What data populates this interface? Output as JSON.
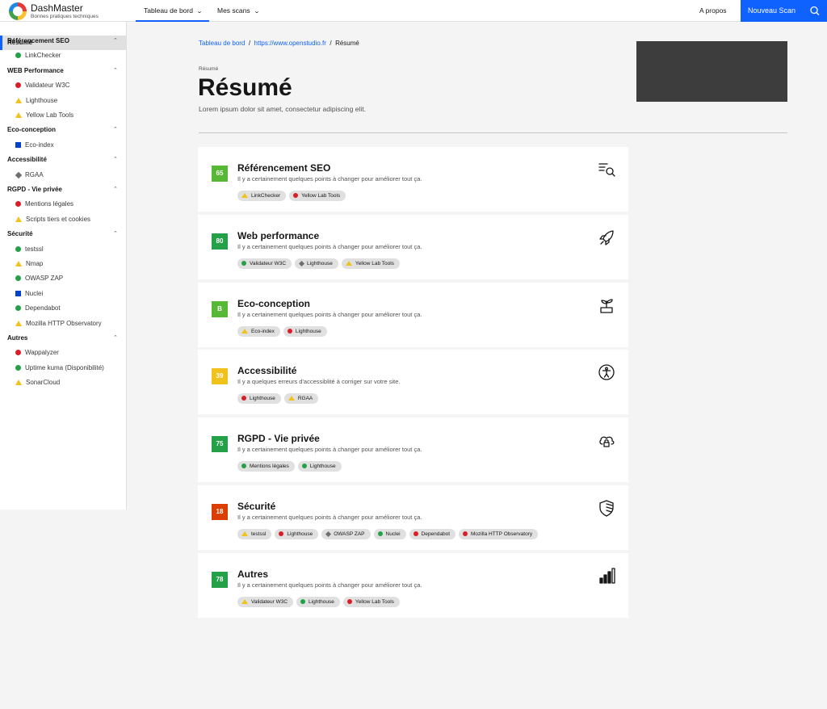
{
  "header": {
    "brand": "DashMaster",
    "subtitle": "Bonnes pratiques techniques",
    "nav": [
      {
        "label": "Tableau de bord"
      },
      {
        "label": "Mes scans"
      }
    ],
    "apropos": "A propos",
    "new_scan": "Nouveau Scan"
  },
  "sidebar": {
    "resume": "Résumé",
    "categories": [
      {
        "label": "Référencement SEO",
        "items": [
          {
            "label": "LinkChecker",
            "status": "ok"
          }
        ]
      },
      {
        "label": "WEB Performance",
        "items": [
          {
            "label": "Validateur W3C",
            "status": "err"
          },
          {
            "label": "Lighthouse",
            "status": "warn"
          },
          {
            "label": "Yellow Lab Tools",
            "status": "warn"
          }
        ]
      },
      {
        "label": "Eco-conception",
        "items": [
          {
            "label": "Eco-index",
            "status": "info"
          }
        ]
      },
      {
        "label": "Accessibilité",
        "items": [
          {
            "label": "RGAA",
            "status": "na"
          }
        ]
      },
      {
        "label": "RGPD - Vie privée",
        "items": [
          {
            "label": "Mentions légales",
            "status": "err"
          },
          {
            "label": "Scripts tiers et cookies",
            "status": "warn"
          }
        ]
      },
      {
        "label": "Sécurité",
        "items": [
          {
            "label": "testssl",
            "status": "ok"
          },
          {
            "label": "Nmap",
            "status": "warn"
          },
          {
            "label": "OWASP ZAP",
            "status": "ok"
          },
          {
            "label": "Nuclei",
            "status": "info"
          },
          {
            "label": "Dependabot",
            "status": "ok"
          },
          {
            "label": "Mozilla HTTP Observatory",
            "status": "warn"
          }
        ]
      },
      {
        "label": "Autres",
        "items": [
          {
            "label": "Wappalyzer",
            "status": "err"
          },
          {
            "label": "Uptime kuma (Disponibilité)",
            "status": "ok"
          },
          {
            "label": "SonarCloud",
            "status": "warn"
          }
        ]
      }
    ]
  },
  "breadcrumb": {
    "home": "Tableau de bord",
    "site": "https://www.openstudio.fr",
    "current": "Résumé"
  },
  "page": {
    "eyebrow": "Résumé",
    "title": "Résumé",
    "description": "Lorem ipsum dolor sit amet, consectetur adipiscing elit."
  },
  "colors": {
    "ok": "#24a148",
    "err": "#da1e28",
    "warn": "#f1c21b",
    "info": "#0043ce",
    "na": "#6f6f6f",
    "accent": "#0f62fe"
  },
  "cards": [
    {
      "title": "Référencement SEO",
      "score": "65",
      "score_color": "#56b835",
      "desc": "Il y a certainement quelques points à changer pour améliorer tout ça.",
      "icon": "search-list-icon",
      "tags": [
        {
          "label": "LinkChecker",
          "status": "warn"
        },
        {
          "label": "Yellow Lab Tools",
          "status": "err"
        }
      ]
    },
    {
      "title": "Web performance",
      "score": "80",
      "score_color": "#24a148",
      "desc": "Il y a certainement quelques points à changer pour améliorer tout ça.",
      "icon": "rocket-icon",
      "tags": [
        {
          "label": "Validateur W3C",
          "status": "ok"
        },
        {
          "label": "Lighthouse",
          "status": "na"
        },
        {
          "label": "Yellow Lab Tools",
          "status": "warn"
        }
      ]
    },
    {
      "title": "Eco-conception",
      "score": "B",
      "score_color": "#56b835",
      "desc": "Il y a certainement quelques points à changer pour améliorer tout ça.",
      "icon": "plant-icon",
      "tags": [
        {
          "label": "Eco-index",
          "status": "warn"
        },
        {
          "label": "Lighthouse",
          "status": "err"
        }
      ]
    },
    {
      "title": "Accessibilité",
      "score": "39",
      "score_color": "#f1c21b",
      "desc": "Il y a quelques erreurs d'accessiblité à corriger sur votre site.",
      "icon": "accessibility-icon",
      "tags": [
        {
          "label": "Lighthouse",
          "status": "err"
        },
        {
          "label": "RGAA",
          "status": "warn"
        }
      ]
    },
    {
      "title": "RGPD - Vie privée",
      "score": "75",
      "score_color": "#24a148",
      "desc": "Il y a certainement quelques points à changer pour améliorer tout ça.",
      "icon": "cloud-lock-icon",
      "tags": [
        {
          "label": "Mentions légales",
          "status": "ok"
        },
        {
          "label": "Lighthouse",
          "status": "ok"
        }
      ]
    },
    {
      "title": "Sécurité",
      "score": "18",
      "score_color": "#da3e00",
      "desc": "Il y a certainement quelques points à changer pour améliorer tout ça.",
      "icon": "shield-icon",
      "tags": [
        {
          "label": "testssl",
          "status": "warn"
        },
        {
          "label": "Lighthouse",
          "status": "err"
        },
        {
          "label": "OWASP ZAP",
          "status": "na"
        },
        {
          "label": "Nuclei",
          "status": "ok"
        },
        {
          "label": "Dependabot",
          "status": "err"
        },
        {
          "label": "Mozilla HTTP Observatory",
          "status": "err"
        }
      ]
    },
    {
      "title": "Autres",
      "score": "78",
      "score_color": "#24a148",
      "desc": "Il y a certainement quelques points à changer pour améliorer tout ça.",
      "icon": "bar-chart-icon",
      "tags": [
        {
          "label": "Validateur W3C",
          "status": "warn"
        },
        {
          "label": "Lighthouse",
          "status": "ok"
        },
        {
          "label": "Yellow Lab Tools",
          "status": "err"
        }
      ]
    }
  ]
}
